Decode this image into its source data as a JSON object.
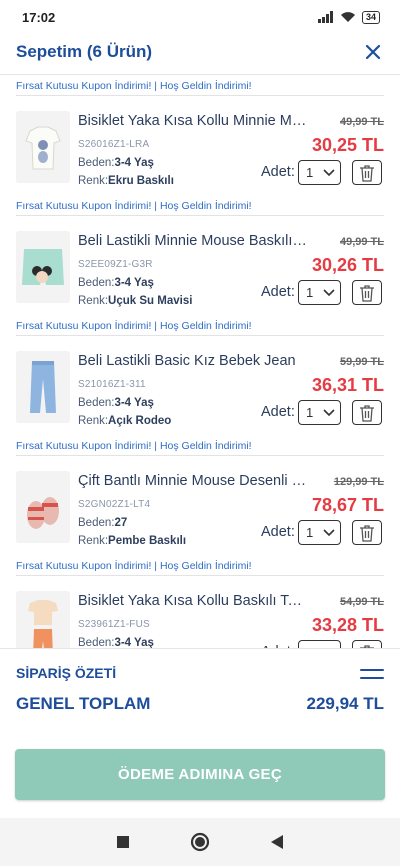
{
  "status": {
    "time": "17:02",
    "battery": "34"
  },
  "header": {
    "title": "Sepetim (6 Ürün)"
  },
  "promo_text": "Fırsat Kutusu Kupon İndirimi! | Hoş Geldin İndirimi!",
  "labels": {
    "size": "Beden:",
    "color": "Renk:",
    "qty": "Adet:"
  },
  "items": [
    {
      "name": "Bisiklet Yaka Kısa Kollu Minnie Mouse",
      "sku": "S26016Z1-LRA",
      "size": "3-4 Yaş",
      "color": "Ekru Baskılı",
      "old_price": "49,99 TL",
      "price": "30,25 TL",
      "qty": "1"
    },
    {
      "name": "Beli Lastikli Minnie Mouse Baskılı Şort",
      "sku": "S2EE09Z1-G3R",
      "size": "3-4 Yaş",
      "color": "Uçuk Su Mavisi",
      "old_price": "49,99 TL",
      "price": "30,26 TL",
      "qty": "1"
    },
    {
      "name": "Beli Lastikli Basic Kız Bebek Jean",
      "sku": "S21016Z1-311",
      "size": "3-4 Yaş",
      "color": "Açık Rodeo",
      "old_price": "59,99 TL",
      "price": "36,31 TL",
      "qty": "1"
    },
    {
      "name": "Çift Bantlı Minnie Mouse Desenli Sandalet",
      "sku": "S2GN02Z1-LT4",
      "size": "27",
      "color": "Pembe Baskılı",
      "old_price": "129,99 TL",
      "price": "78,67 TL",
      "qty": "1"
    },
    {
      "name": "Bisiklet Yaka Kısa Kollu Baskılı Takım",
      "sku": "S23961Z1-FUS",
      "size": "3-4 Yaş",
      "color": "",
      "old_price": "54,99 TL",
      "price": "33,28 TL",
      "qty": "1"
    }
  ],
  "summary": {
    "title": "SİPARİŞ ÖZETİ",
    "total_label": "GENEL TOPLAM",
    "total_value": "229,94 TL"
  },
  "checkout": {
    "label": "ÖDEME ADIMINA GEÇ"
  },
  "colors": {
    "brand": "#1d4d9b",
    "price": "#e53b43",
    "link": "#2f6dc4",
    "checkout": "#8fc9b8"
  }
}
